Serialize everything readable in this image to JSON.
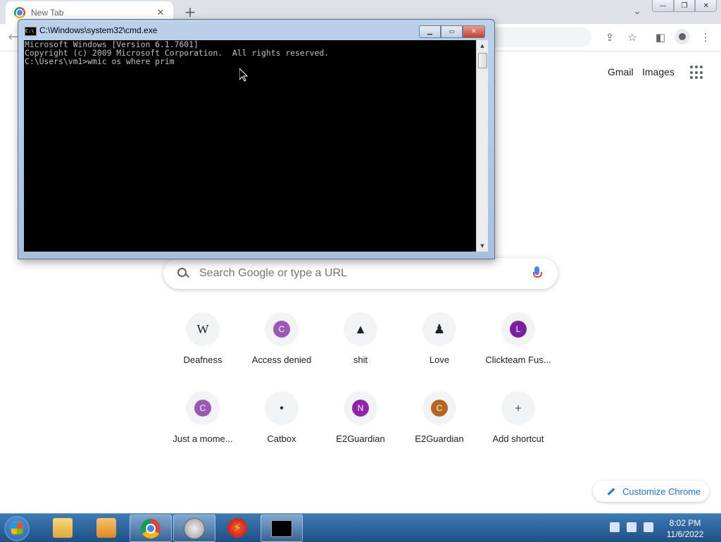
{
  "browser": {
    "tab_title": "New Tab",
    "tab_close": "✕",
    "new_tab": "+",
    "tab_search": "⌄",
    "window_controls": {
      "minimize": "—",
      "restore": "❐",
      "close": "✕"
    }
  },
  "ntp": {
    "gmail_label": "Gmail",
    "images_label": "Images",
    "search_placeholder": "Search Google or type a URL",
    "shortcuts": [
      {
        "label": "Deafness",
        "letter": "W",
        "color": "#f1f3f4"
      },
      {
        "label": "Access denied",
        "letter": "C",
        "color": "#9b59b6"
      },
      {
        "label": "shit",
        "letter": "▲",
        "color": "#f1f3f4"
      },
      {
        "label": "Love",
        "letter": "♟",
        "color": "#f1f3f4"
      },
      {
        "label": "Clickteam Fus...",
        "letter": "L",
        "color": "#7b1fa2"
      },
      {
        "label": "Just a mome...",
        "letter": "C",
        "color": "#9b59b6"
      },
      {
        "label": "Catbox",
        "letter": "•",
        "color": "#f1f3f4"
      },
      {
        "label": "E2Guardian",
        "letter": "N",
        "color": "#8e24aa"
      },
      {
        "label": "E2Guardian",
        "letter": "C",
        "color": "#b5651d"
      },
      {
        "label": "Add shortcut",
        "letter": "+",
        "color": "#f1f3f4"
      }
    ],
    "customize_label": "Customize Chrome"
  },
  "cmd": {
    "title": "C:\\Windows\\system32\\cmd.exe",
    "icon_text": "C:\\",
    "lines": [
      "Microsoft Windows [Version 6.1.7601]",
      "Copyright (c) 2009 Microsoft Corporation.  All rights reserved.",
      "",
      "C:\\Users\\vm1>wmic os where prim"
    ]
  },
  "taskbar": {
    "time": "8:02 PM",
    "date": "11/6/2022",
    "apps": [
      "file-explorer",
      "media-player",
      "chrome",
      "safari",
      "flash",
      "cmd"
    ]
  }
}
